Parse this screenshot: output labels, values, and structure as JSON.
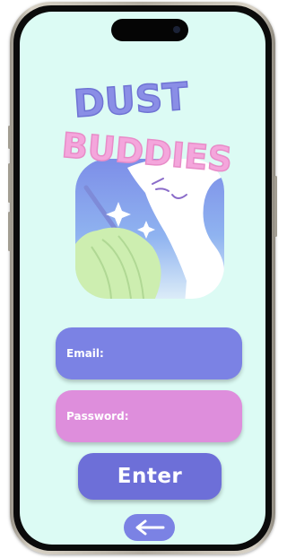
{
  "app": {
    "title_line1": "DUST",
    "title_line2": "BUDDIES"
  },
  "colors": {
    "screen_bg": "#dcfbf4",
    "email_field": "#7b82e4",
    "password_field": "#de8edc",
    "enter_button": "#6d6fd8",
    "title_line1": "#8a8ee6",
    "title_line2": "#f4a6dc"
  },
  "icons": {
    "logo": "cat-with-broom-icon",
    "back": "arrow-left-icon"
  },
  "form": {
    "email_label": "Email:",
    "email_value": "",
    "password_label": "Password:",
    "password_value": "",
    "enter_label": "Enter"
  }
}
